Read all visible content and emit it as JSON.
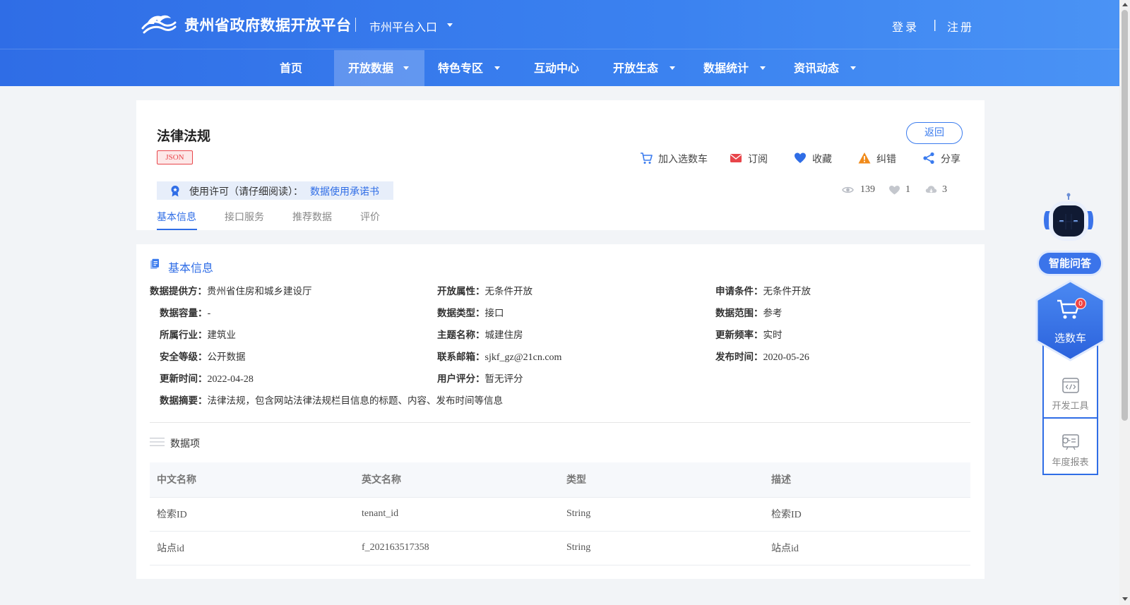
{
  "header": {
    "site_title": "贵州省政府数据开放平台",
    "city_entry": "市州平台入口",
    "login": "登录",
    "auth_separator": "|",
    "register": "注册"
  },
  "nav": {
    "items": [
      {
        "label": "首页"
      },
      {
        "label": "开放数据",
        "active": true,
        "dropdown": true
      },
      {
        "label": "特色专区",
        "dropdown": true
      },
      {
        "label": "互动中心"
      },
      {
        "label": "开放生态",
        "dropdown": true
      },
      {
        "label": "数据统计",
        "dropdown": true
      },
      {
        "label": "资讯动态",
        "dropdown": true
      }
    ]
  },
  "dataset": {
    "title": "法律法规",
    "format_badge": "JSON",
    "back_label": "返回",
    "actions": [
      {
        "label": "加入选数车",
        "icon": "cart-icon"
      },
      {
        "label": "订阅",
        "icon": "mail-icon"
      },
      {
        "label": "收藏",
        "icon": "heart-icon"
      },
      {
        "label": "纠错",
        "icon": "warning-icon"
      },
      {
        "label": "分享",
        "icon": "share-icon"
      }
    ],
    "license_text": "使用许可（请仔细阅读）：",
    "license_link": "数据使用承诺书",
    "stats": {
      "views": "139",
      "likes": "1",
      "downloads": "3"
    },
    "tabs": [
      {
        "label": "基本信息",
        "active": true
      },
      {
        "label": "接口服务"
      },
      {
        "label": "推荐数据"
      },
      {
        "label": "评价"
      }
    ]
  },
  "basic_info": {
    "section_title": "基本信息",
    "fields": {
      "provider": {
        "label": "数据提供方：",
        "value": "贵州省住房和城乡建设厅"
      },
      "open_attr": {
        "label": "开放属性：",
        "value": "无条件开放"
      },
      "apply_cond": {
        "label": "申请条件：",
        "value": "无条件开放"
      },
      "capacity": {
        "label": "数据容量：",
        "value": "-"
      },
      "data_type": {
        "label": "数据类型：",
        "value": "接口"
      },
      "data_scope": {
        "label": "数据范围：",
        "value": "参考"
      },
      "industry": {
        "label": "所属行业：",
        "value": "建筑业"
      },
      "topic": {
        "label": "主题名称：",
        "value": "城建住房"
      },
      "frequency": {
        "label": "更新频率：",
        "value": "实时"
      },
      "security": {
        "label": "安全等级：",
        "value": "公开数据"
      },
      "email": {
        "label": "联系邮箱：",
        "value": "sjkf_gz@21cn.com"
      },
      "publish_time": {
        "label": "发布时间：",
        "value": "2020-05-26"
      },
      "update_time": {
        "label": "更新时间：",
        "value": "2022-04-28"
      },
      "rating": {
        "label": "用户评分：",
        "value": "暂无评分"
      },
      "summary": {
        "label": "数据摘要：",
        "value": "法律法规，包含网站法律法规栏目信息的标题、内容、发布时间等信息"
      }
    }
  },
  "data_items": {
    "title": "数据项",
    "columns": [
      "中文名称",
      "英文名称",
      "类型",
      "描述"
    ],
    "rows": [
      [
        "检索ID",
        "tenant_id",
        "String",
        "检索ID"
      ],
      [
        "站点id",
        "f_202163517358",
        "String",
        "站点id"
      ]
    ]
  },
  "sidebar": {
    "ai_label": "智能问答",
    "cart_label": "选数车",
    "cart_count": "0",
    "dev_tools_label": "开发工具",
    "annual_report_label": "年度报表"
  },
  "colors": {
    "brand_blue": "#2f6de6",
    "header_gradient_end": "#4a93f5",
    "badge_red": "#e8454a",
    "page_bg": "#f2f4f7"
  }
}
